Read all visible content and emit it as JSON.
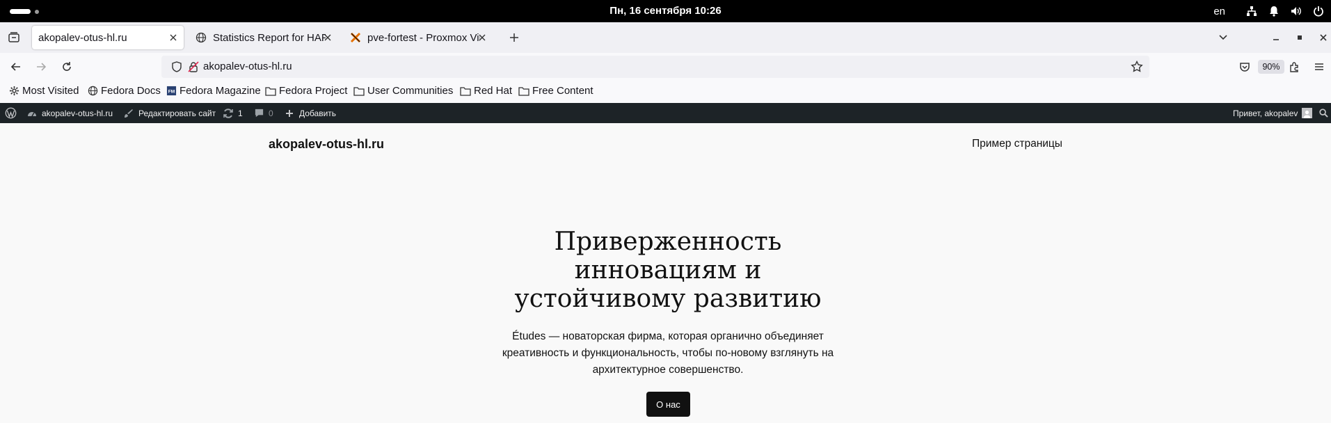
{
  "system": {
    "clock": "Пн, 16 сентября  10:26",
    "language": "en"
  },
  "tabs": [
    {
      "title": "akopalev-otus-hl.ru",
      "active": true
    },
    {
      "title": "Statistics Report for HAPr",
      "active": false
    },
    {
      "title": "pve-fortest - Proxmox Vir",
      "active": false
    }
  ],
  "url": {
    "address": "akopalev-otus-hl.ru",
    "zoom": "90%"
  },
  "bookmarks": [
    {
      "label": "Most Visited",
      "icon": "gear-icon"
    },
    {
      "label": "Fedora Docs",
      "icon": "globe-icon"
    },
    {
      "label": "Fedora Magazine",
      "icon": "fedora-magazine-icon"
    },
    {
      "label": "Fedora Project",
      "icon": "folder-icon"
    },
    {
      "label": "User Communities",
      "icon": "folder-icon"
    },
    {
      "label": "Red Hat",
      "icon": "folder-icon"
    },
    {
      "label": "Free Content",
      "icon": "folder-icon"
    }
  ],
  "wp_admin": {
    "site": "akopalev-otus-hl.ru",
    "edit_site": "Редактировать сайт",
    "updates_count": "1",
    "comments_count": "0",
    "add_new": "Добавить",
    "greeting": "Привет, akopalev"
  },
  "site": {
    "title": "akopalev-otus-hl.ru",
    "nav_link": "Пример страницы",
    "hero_line1": "Приверженность",
    "hero_line2": "инновациям и",
    "hero_line3": "устойчивому развитию",
    "hero_text": "Études — новаторская фирма, которая органично объединяет креативность и функциональность, чтобы по-новому взглянуть на архитектурное совершенство.",
    "button": "О нас"
  },
  "colors": {
    "wp_bar": "#1d2327",
    "page_bg": "#f9f9f9",
    "button_bg": "#111111"
  }
}
